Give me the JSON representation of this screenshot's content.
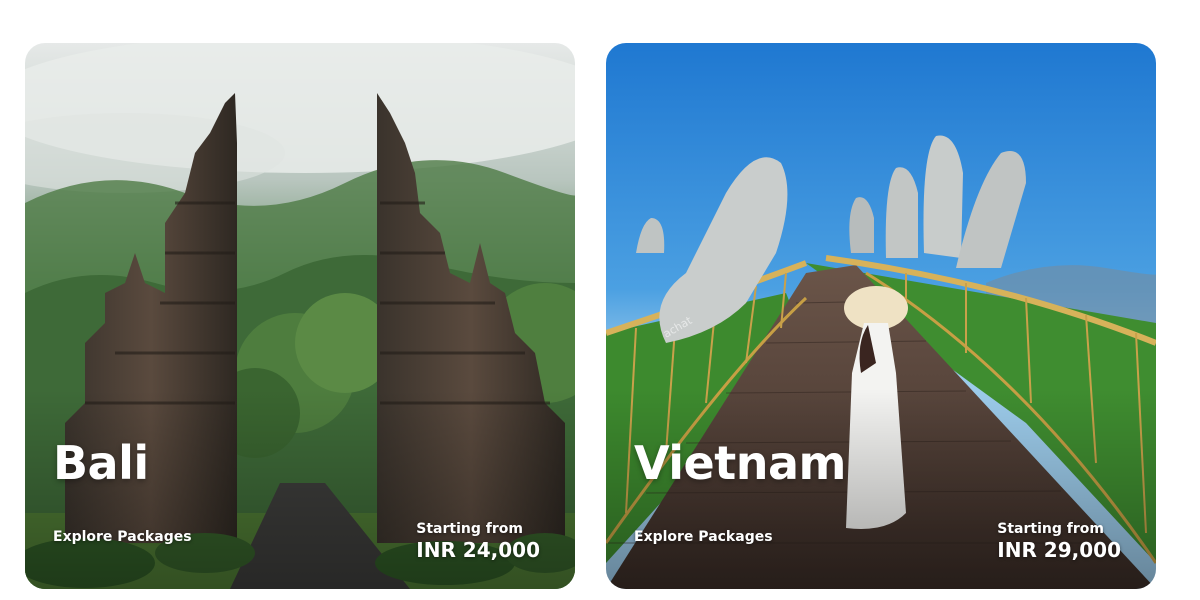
{
  "cards": [
    {
      "destination": "Bali",
      "cta": "Explore Packages",
      "price_label": "Starting from",
      "price": "INR 24,000"
    },
    {
      "destination": "Vietnam",
      "cta": "Explore Packages",
      "price_label": "Starting from",
      "price": "INR 29,000"
    }
  ],
  "colors": {
    "text": "#ffffff",
    "bali_foliage": "#3f6b3a",
    "bali_mist": "#d9dede",
    "vietnam_sky": "#2f8fd8",
    "vietnam_walkway": "#4a3a33",
    "vietnam_railing": "#c9a14a"
  },
  "watermark": "achat"
}
